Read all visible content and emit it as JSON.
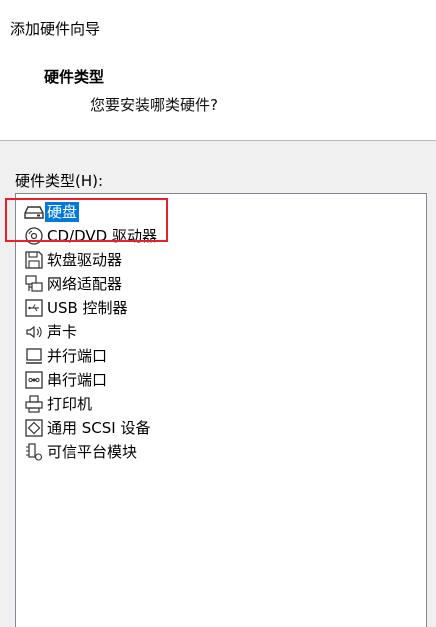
{
  "window": {
    "title": "添加硬件向导"
  },
  "header": {
    "title": "硬件类型",
    "subtitle": "您要安装哪类硬件?"
  },
  "list": {
    "label": "硬件类型(H):",
    "items": [
      {
        "label": "硬盘",
        "icon": "hard-disk-icon",
        "selected": true
      },
      {
        "label": "CD/DVD 驱动器",
        "icon": "cd-dvd-icon"
      },
      {
        "label": "软盘驱动器",
        "icon": "floppy-icon"
      },
      {
        "label": "网络适配器",
        "icon": "network-adapter-icon"
      },
      {
        "label": "USB 控制器",
        "icon": "usb-icon"
      },
      {
        "label": "声卡",
        "icon": "speaker-icon"
      },
      {
        "label": "并行端口",
        "icon": "parallel-port-icon"
      },
      {
        "label": "串行端口",
        "icon": "serial-port-icon"
      },
      {
        "label": "打印机",
        "icon": "printer-icon"
      },
      {
        "label": "通用 SCSI 设备",
        "icon": "scsi-icon"
      },
      {
        "label": "可信平台模块",
        "icon": "tpm-icon"
      }
    ]
  },
  "colors": {
    "selection": "#0078d7",
    "highlight_box": "#e8202a",
    "panel_bg": "#f0f0f0"
  }
}
